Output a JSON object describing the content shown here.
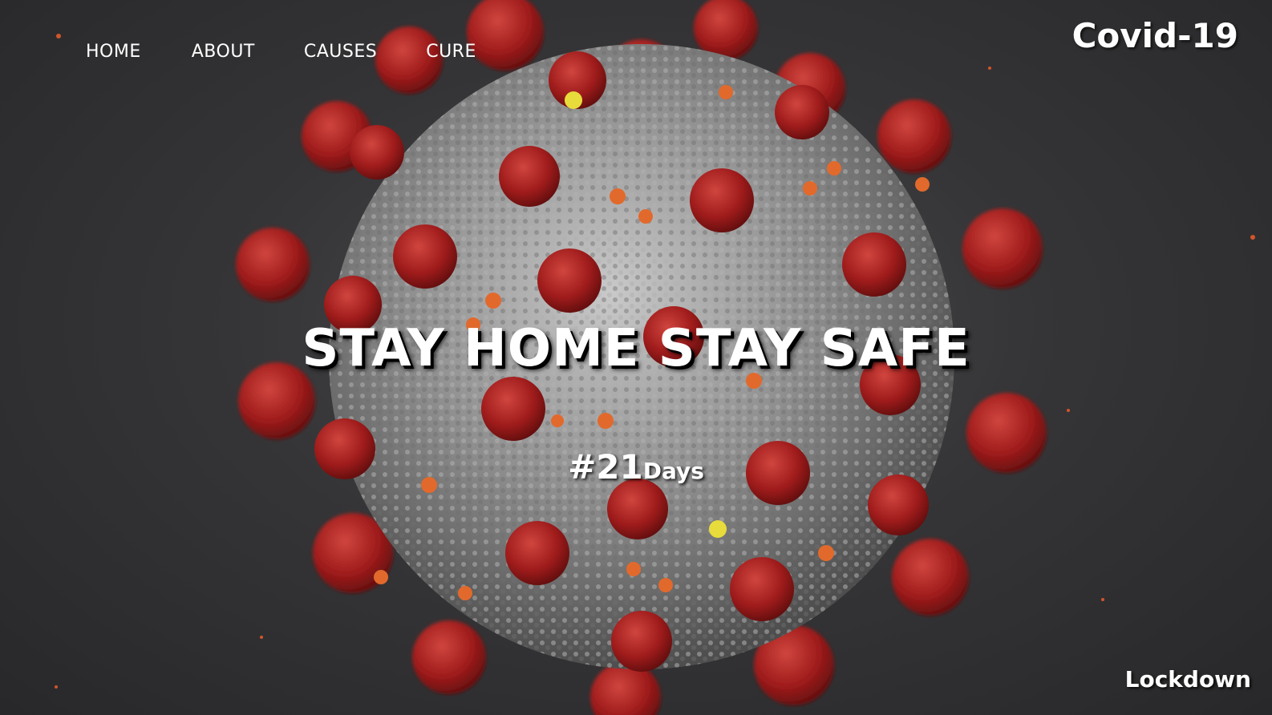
{
  "nav": {
    "items": [
      {
        "label": "HOME"
      },
      {
        "label": "ABOUT"
      },
      {
        "label": "CAUSES"
      },
      {
        "label": "CURE"
      }
    ]
  },
  "brand": {
    "title": "Covid-19"
  },
  "hero": {
    "headline": "STAY HOME STAY SAFE",
    "hashtag_main": "#21",
    "hashtag_sub": "Days",
    "background_icon": "coronavirus-illustration"
  },
  "footer": {
    "label": "Lockdown"
  },
  "colors": {
    "background": "#333335",
    "virus_body": "#9a9a9a",
    "spike": "#a81c1c",
    "accent_orange": "#e2692c",
    "accent_yellow": "#e7dc3b",
    "text": "#ffffff"
  }
}
